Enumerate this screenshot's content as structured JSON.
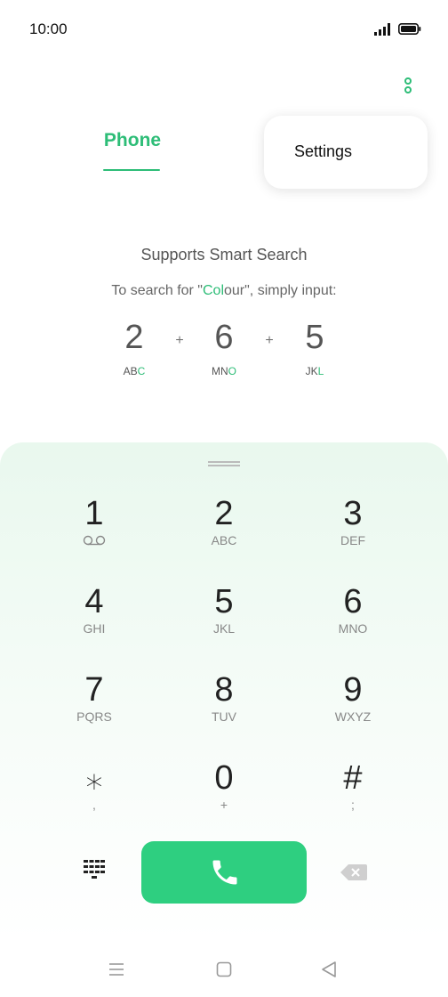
{
  "status_bar": {
    "time": "10:00"
  },
  "tabs": {
    "phone_label": "Phone"
  },
  "popup_menu": {
    "settings_label": "Settings"
  },
  "smart_search": {
    "title": "Supports Smart Search",
    "sub_prefix": "To search for \"",
    "sub_highlight": "Col",
    "sub_rest": "our\", simply input:",
    "example": [
      {
        "digit": "2",
        "letters_plain": "AB",
        "letters_highlight": "C",
        "letters_after": ""
      },
      {
        "digit": "6",
        "letters_plain": "MN",
        "letters_highlight": "O",
        "letters_after": ""
      },
      {
        "digit": "5",
        "letters_plain": "JK",
        "letters_highlight": "L",
        "letters_after": ""
      }
    ],
    "plus": "+"
  },
  "dialpad": {
    "keys": [
      {
        "digit": "1",
        "sub": ""
      },
      {
        "digit": "2",
        "sub": "ABC"
      },
      {
        "digit": "3",
        "sub": "DEF"
      },
      {
        "digit": "4",
        "sub": "GHI"
      },
      {
        "digit": "5",
        "sub": "JKL"
      },
      {
        "digit": "6",
        "sub": "MNO"
      },
      {
        "digit": "7",
        "sub": "PQRS"
      },
      {
        "digit": "8",
        "sub": "TUV"
      },
      {
        "digit": "9",
        "sub": "WXYZ"
      },
      {
        "digit": "⁎",
        "sub": ","
      },
      {
        "digit": "0",
        "sub": "+"
      },
      {
        "digit": "#",
        "sub": ";"
      }
    ]
  },
  "colors": {
    "accent": "#2dbd77",
    "call_button": "#2ecf80"
  },
  "icons": {
    "signal": "signal-icon",
    "battery": "battery-icon",
    "more": "more-vertical-icon",
    "voicemail": "voicemail-icon",
    "dialpad": "dialpad-icon",
    "phone": "phone-icon",
    "backspace": "backspace-icon"
  }
}
